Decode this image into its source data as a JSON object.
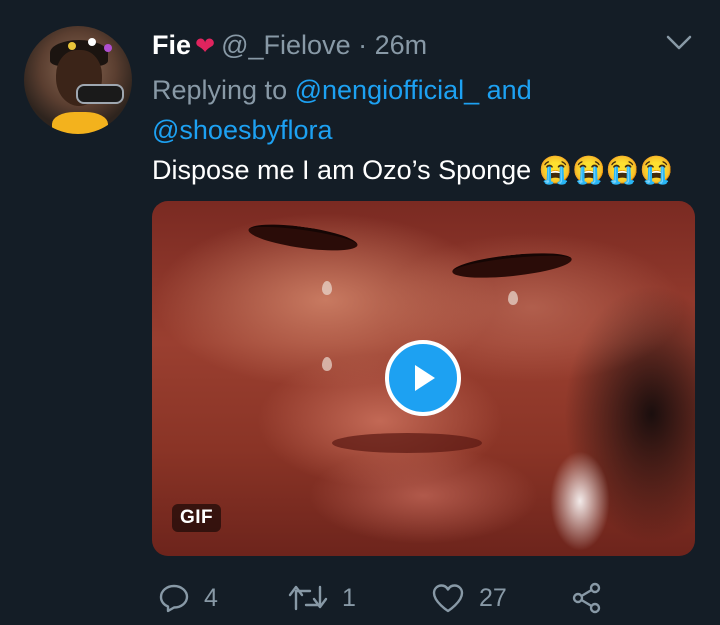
{
  "tweet": {
    "author_name": "Fie",
    "heart": "❤",
    "handle": "@_Fielove",
    "separator": "·",
    "time": "26m",
    "replying_prefix": "Replying to",
    "reply_user_1": "@nengiofficial_",
    "reply_joiner": "and",
    "reply_user_2": "@shoesbyflora",
    "text": "Dispose me I am Ozo’s Sponge 😭😭😭😭",
    "media": {
      "badge": "GIF"
    },
    "actions": {
      "reply_count": "4",
      "retweet_count": "1",
      "like_count": "27"
    }
  },
  "colors": {
    "background": "#141d26",
    "link": "#1da1f2",
    "muted": "#8899a6",
    "heart": "#e0245e"
  },
  "icons": {
    "menu": "chevron-down-icon",
    "play": "play-icon",
    "reply": "reply-icon",
    "retweet": "retweet-icon",
    "like": "heart-outline-icon",
    "share": "share-icon"
  }
}
